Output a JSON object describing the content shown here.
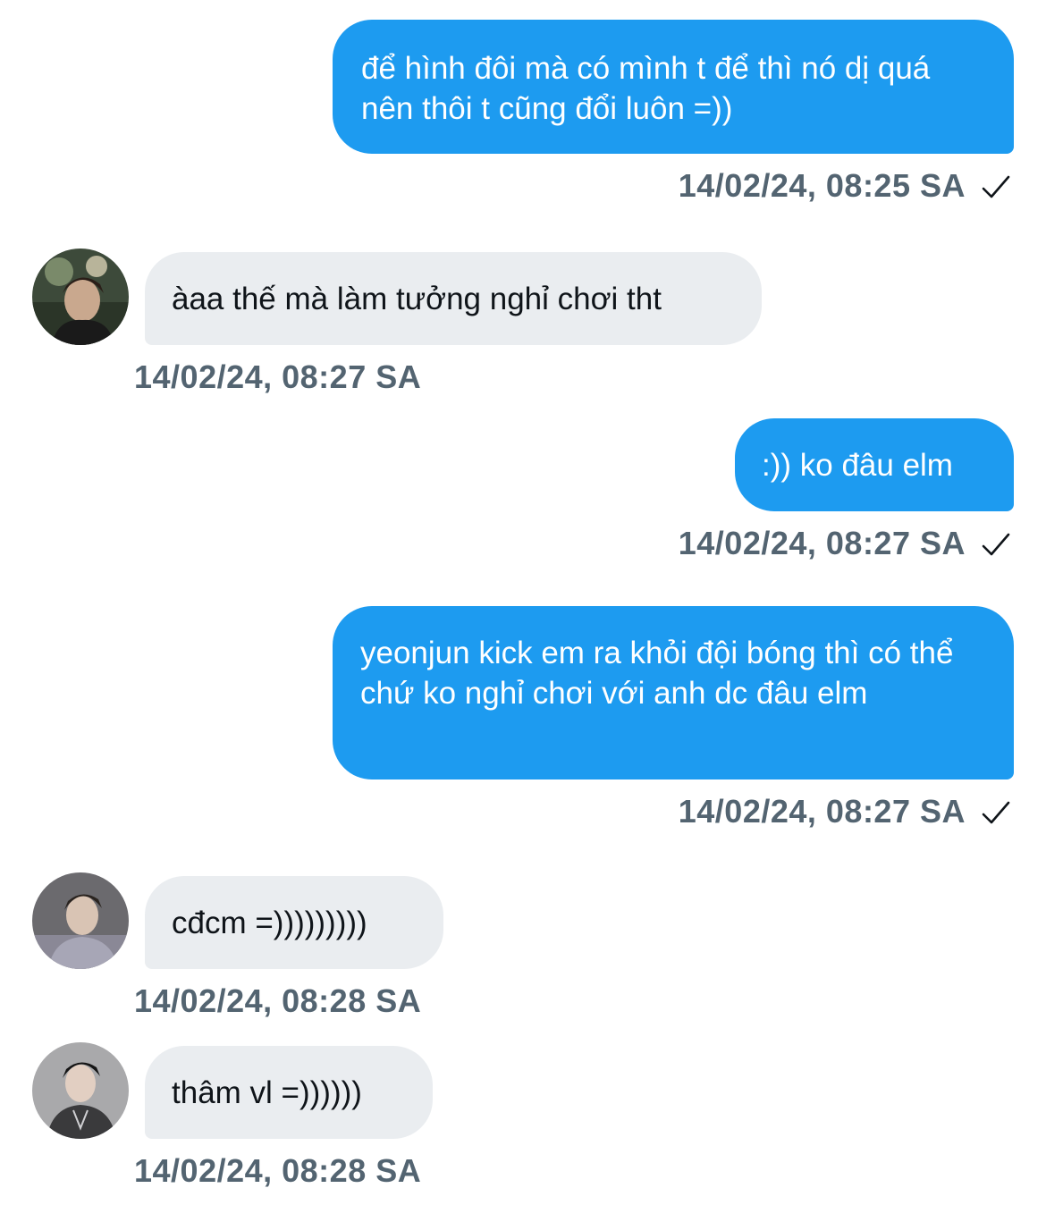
{
  "conversation": {
    "messages": [
      {
        "direction": "outgoing",
        "text": "để hình đôi mà có mình t để thì nó dị quá nên thôi t cũng đổi luôn =))",
        "timestamp": "14/02/24, 08:25 SA",
        "read_icon": "check-icon"
      },
      {
        "direction": "incoming",
        "text": "àaa thế mà làm tưởng nghỉ chơi tht",
        "timestamp": "14/02/24, 08:27 SA",
        "avatar_icon": "avatar"
      },
      {
        "direction": "outgoing",
        "text": ":)) ko đâu elm",
        "timestamp": "14/02/24, 08:27 SA",
        "read_icon": "check-icon"
      },
      {
        "direction": "outgoing",
        "text": "yeonjun kick em ra khỏi đội bóng thì có thể chứ ko nghỉ chơi với anh dc đâu elm",
        "timestamp": "14/02/24, 08:27 SA",
        "read_icon": "check-icon"
      },
      {
        "direction": "incoming",
        "text": "cđcm =)))))))))",
        "timestamp": "14/02/24, 08:28 SA",
        "avatar_icon": "avatar"
      },
      {
        "direction": "incoming",
        "text": "thâm vl =))))))",
        "timestamp": "14/02/24, 08:28 SA",
        "avatar_icon": "avatar"
      }
    ]
  },
  "colors": {
    "outgoing_bubble": "#1d9bf0",
    "incoming_bubble": "#eaedf0",
    "timestamp": "#536471",
    "incoming_text": "#0f1419",
    "outgoing_text": "#ffffff"
  }
}
